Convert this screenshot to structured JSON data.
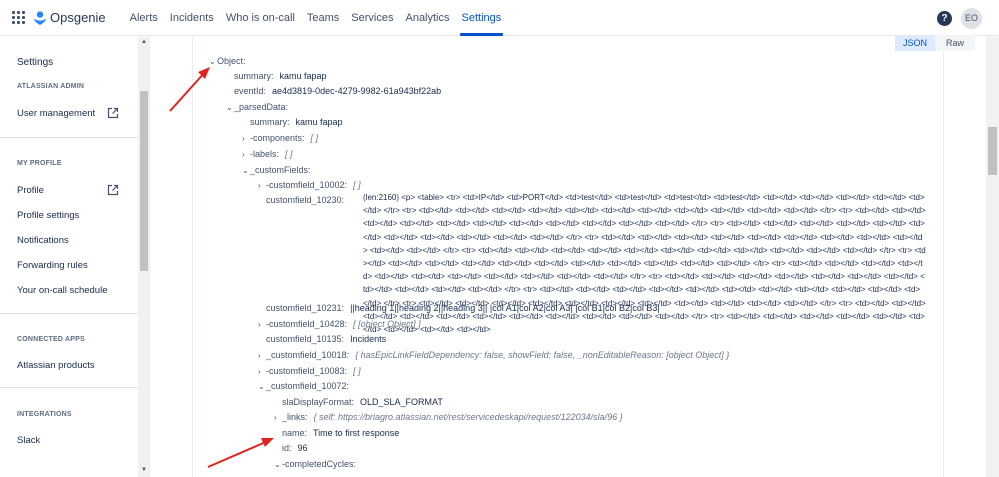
{
  "nav": {
    "brand": "Opsgenie",
    "items": [
      "Alerts",
      "Incidents",
      "Who is on-call",
      "Teams",
      "Services",
      "Analytics",
      "Settings"
    ],
    "active": "Settings",
    "help": "?",
    "avatar": "EO"
  },
  "sidebar": {
    "title": "Settings",
    "sections": {
      "admin": "ATLASSIAN ADMIN",
      "profile": "MY PROFILE",
      "apps": "CONNECTED APPS",
      "integrations": "INTEGRATIONS"
    },
    "items": {
      "user_management": "User management",
      "profile": "Profile",
      "profile_settings": "Profile settings",
      "notifications": "Notifications",
      "forwarding_rules": "Forwarding rules",
      "on_call_schedule": "Your on-call schedule",
      "atlassian_products": "Atlassian products",
      "slack": "Slack"
    }
  },
  "viewer": {
    "json_tab": "JSON",
    "raw_tab": "Raw",
    "root": "Object:",
    "summary_key": "summary:",
    "summary_val": "kamu fapap",
    "eventid_key": "eventId:",
    "eventid_val": "ae4d3819-0dec-4279-9982-61a943bf22ab",
    "parsed_key": "_parsedData:",
    "p_summary_key": "summary:",
    "p_summary_val": "kamu fapap",
    "components_key": "-components:",
    "components_val": "[ ]",
    "labels_key": "-labels:",
    "labels_val": "[ ]",
    "custom_key": "_customFields:",
    "cf10002_key": "-customfield_10002:",
    "cf10002_val": "[ ]",
    "cf10230_key": "customfield_10230:",
    "cf10230_val": "(len:2160) <p> <table> <tr> <td>IP</td> <td>PORT</td> <td>test</td> <td>test</td> <td>test</td> <td>test</td> <td></td> <td></td> <td></td> <td></td> <td></td> </tr> <tr> <td></td> <td></td> <td></td> <td></td> <td></td> <td></td> <td></td> <td></td> <td></td> <td></td> <td></td> </tr> <tr> <td></td> <td></td> <td></td> <td></td> <td></td> <td></td> <td></td> <td></td> <td></td> <td></td> <td></td> </tr> <tr> <td></td> <td></td> <td></td> <td></td> <td></td> <td></td> <td></td> <td></td> <td></td> <td></td> <td></td> </tr> <tr> <td></td> <td></td> <td></td> <td></td> <td></td> <td></td> <td></td> <td></td> <td></td> <td></td> <td></td> </tr> <tr> <td></td> <td></td> <td></td> <td></td> <td></td> <td></td> <td></td> <td></td> <td></td> <td></td> <td></td> </tr> <tr> <td></td> <td></td> <td></td> <td></td> <td></td> <td></td> <td></td> <td></td> <td></td> <td></td> <td></td> </tr> <tr> <td></td> <td></td> <td></td> <td></td> <td></td> <td></td> <td></td> <td></td> <td></td> <td></td> <td></td> </tr> <tr> <td></td> <td></td> <td></td> <td></td> <td></td> <td></td> <td></td> <td></td> <td></td> <td></td> <td></td> </tr> <tr> <td></td> <td></td> <td></td> <td></td> <td></td> <td></td> <td></td> <td></td> <td></td> <td></td> <td></td> </tr> <tr> <td></td> <td></td> <td></td> <td></td> <td></td> <td></td> <td></td> <td></td> <td></td> <td></td> <td></td> </tr> <tr> <td></td> <td></td> <td></td> <td></td> <td></td> <td></td> <td></td> <td></td> <td></td> <td></td> <td></td> </tr> <tr> <td></td> <td></td> <td></td> <td></td> <td></td> <td></td> <td></td> <td></td> <td></td>",
    "cf10231_key": "customfield_10231:",
    "cf10231_val": "||heading 1||heading 2||heading 3|| |col A1|col A2|col A3| |col B1|col B2|col B3|",
    "cf10428_key": "-customfield_10428:",
    "cf10428_val": "[ [object Object] ]",
    "cf10135_key": "customfield_10135:",
    "cf10135_val": "Incidents",
    "cf10018_key": "_customfield_10018:",
    "cf10018_val": "{ hasEpicLinkFieldDependency: false, showField: false, _nonEditableReason: [object Object] }",
    "cf10083_key": "-customfield_10083:",
    "cf10083_val": "[ ]",
    "cf10072_key": "_customfield_10072:",
    "sla_key": "slaDisplayFormat:",
    "sla_val": "OLD_SLA_FORMAT",
    "links_key": "_links:",
    "links_val": "{ self: https://briagro.atlassian.net/rest/servicedeskapi/request/122034/sla/96 }",
    "name_key": "name:",
    "name_val": "Time to first response",
    "id_key": "id:",
    "id_val": "96",
    "completed_key": "-completedCycles:"
  }
}
